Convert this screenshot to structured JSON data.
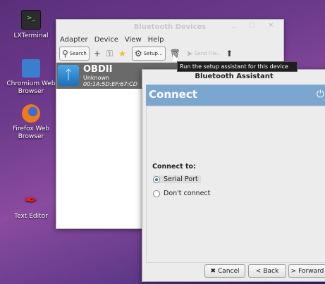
{
  "desktop": {
    "icons": [
      {
        "label": "LXTerminal",
        "icon": "terminal-icon"
      },
      {
        "label": "Chromium Web Browser",
        "icon": "chromium-icon"
      },
      {
        "label": "Firefox Web Browser",
        "icon": "firefox-icon"
      },
      {
        "label": "Text Editor",
        "icon": "text-editor-icon"
      }
    ]
  },
  "bluetooth_window": {
    "title": "Bluetooth Devices",
    "menu": [
      "Adapter",
      "Device",
      "View",
      "Help"
    ],
    "toolbar": {
      "search": "Search",
      "setup": "Setup...",
      "send_file": "Send File..."
    },
    "device": {
      "name": "OBDII",
      "status": "Unknown",
      "address": "00:1A:5D:EF:67:CD"
    }
  },
  "tooltip": "Run the setup assistant for this device",
  "assistant": {
    "title": "Bluetooth Assistant",
    "heading": "Connect",
    "connect_to_label": "Connect to:",
    "options": [
      {
        "label": "Serial Port",
        "selected": true
      },
      {
        "label": "Don't connect",
        "selected": false
      }
    ],
    "buttons": {
      "cancel": "Cancel",
      "back": "Back",
      "forward": "Forward"
    }
  },
  "colors": {
    "header_blue": "#7aa6d0",
    "selected_row": "#6a6a6a"
  }
}
